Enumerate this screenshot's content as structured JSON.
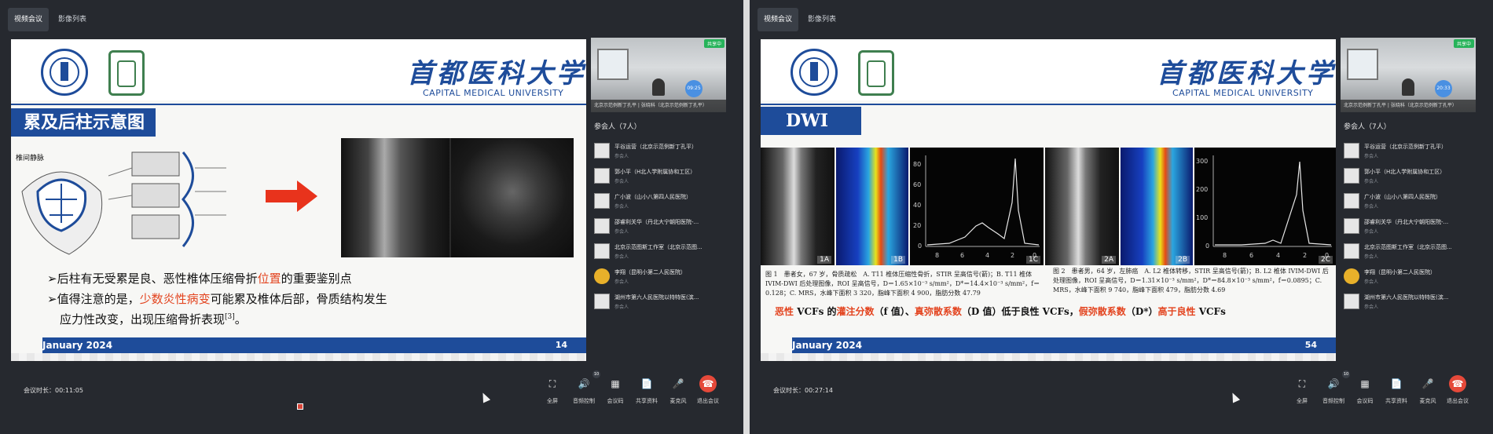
{
  "left": {
    "tabs": [
      "视频会议",
      "影像列表"
    ],
    "slide": {
      "university_zh": "首都医科大学",
      "university_en": "CAPITAL MEDICAL UNIVERSITY",
      "title": "累及后柱示意图",
      "diagram_label": "椎间静脉",
      "bullet1": "➢后柱有无受累是良、恶性椎体压缩骨折",
      "bullet1_hl": "位置",
      "bullet1_end": "的重要鉴别点",
      "bullet2_start": "➢值得注意的是，",
      "bullet2_hl": "少数炎性病变",
      "bullet2_end": "可能累及椎体后部，骨质结构发生",
      "bullet3": "应力性改变，出现压缩骨折表现",
      "bullet3_ref": "[3]",
      "bullet3_end": "。",
      "footer_date": "January 2024",
      "page": "14"
    },
    "side": {
      "sharing": "共享中",
      "time": "09:25",
      "video_caption": "北京示范例新丁孔平 | 张晓科（北京示范例新丁孔平）",
      "participants_title": "参会人（7人）",
      "participants": [
        {
          "name": "平谷运营（北京示范例新丁孔平）",
          "role": "参会人"
        },
        {
          "name": "郭小平（H北人学附属协和工区）",
          "role": "参会人"
        },
        {
          "name": "广小波（山小八第四人民医院）",
          "role": "参会人"
        },
        {
          "name": "邵睿利关华（丹北大宁朝阳医院-...",
          "role": "参会人"
        },
        {
          "name": "北京示范图斯工作室（北京示范图...",
          "role": "参会人"
        },
        {
          "name": "李翔（昆明小第二人民医院）",
          "role": "参会人"
        },
        {
          "name": "湖州市第六人民医院以特特医(滨...",
          "role": "参会人"
        }
      ]
    },
    "duration": "会议时长：00:11:05"
  },
  "right": {
    "tabs": [
      "视频会议",
      "影像列表"
    ],
    "slide": {
      "university_zh": "首都医科大学",
      "university_en": "CAPITAL MEDICAL UNIVERSITY",
      "title": "DWI",
      "panel_labels": [
        "1A",
        "1B",
        "1C",
        "2A",
        "2B",
        "2C"
      ],
      "plot1_yticks": [
        "80",
        "60",
        "40",
        "20",
        "0"
      ],
      "plot1_xticks": [
        "8",
        "6",
        "4",
        "2",
        "0"
      ],
      "plot2_yticks": [
        "300",
        "200",
        "100",
        "0"
      ],
      "plot2_xticks": [
        "8",
        "6",
        "4",
        "2",
        "0"
      ],
      "caption1": "图 1　患者女，67 岁，骨质疏松　A. T11 椎体压缩性骨折，STIR 呈高信号(箭)；B. T11 椎体 IVIM-DWI 后处理图像，ROI 呈高信号，D＝1.65×10⁻³ s/mm²，D*＝14.4×10⁻³ s/mm²，f＝0.128；C. MRS，水峰下面积 3 320，脂峰下面积 4 900，脂肪分数 47.79",
      "caption2": "图 2　患者男，64 岁，左肺癌　A. L2 椎体转移，STIR 呈高信号(箭)；B. L2 椎体 IVIM-DWI 后处理图像，ROI 呈高信号，D＝1.31×10⁻³ s/mm²，D*＝84.8×10⁻³ s/mm²，f＝0.0895；C. MRS，水峰下面积 9 740，脂峰下面积 479，脂肪分数 4.69",
      "summary_parts": [
        "恶性",
        " VCFs 的",
        "灌注分数",
        "（f 值）、",
        "真弥散系数",
        "（D 值）低于良性 VCFs，",
        "假弥散系数",
        "（D*）",
        "高于良性",
        " VCFs"
      ],
      "footer_date": "January 2024",
      "page": "54"
    },
    "side": {
      "sharing": "共享中",
      "time": "20:33",
      "video_caption": "北京示范例新丁孔平 | 张晓科（北京示范例新丁孔平）",
      "participants_title": "参会人（7人）",
      "participants": [
        {
          "name": "平谷运营（北京示范例新丁孔平）",
          "role": "参会人"
        },
        {
          "name": "郭小平（H北人学附属协和工区）",
          "role": "参会人"
        },
        {
          "name": "广小波（山小八第四人民医院）",
          "role": "参会人"
        },
        {
          "name": "邵睿利关华（丹北大宁朝阳医院-...",
          "role": "参会人"
        },
        {
          "name": "北京示范图斯工作室（北京示范图...",
          "role": "参会人"
        },
        {
          "name": "李翔（昆明小第二人民医院）",
          "role": "参会人"
        },
        {
          "name": "湖州市第六人民医院以特特医(滨...",
          "role": "参会人"
        }
      ]
    },
    "duration": "会议时长：00:27:14"
  },
  "controls": [
    {
      "label": "全屏",
      "icon": "fullscreen-icon",
      "glyph": "⛶"
    },
    {
      "label": "音频控制",
      "icon": "speaker-icon",
      "glyph": "🔊",
      "badge": "10"
    },
    {
      "label": "会议码",
      "icon": "qrcode-icon",
      "glyph": "▦"
    },
    {
      "label": "共享资料",
      "icon": "document-icon",
      "glyph": "📄"
    },
    {
      "label": "麦克风",
      "icon": "microphone-icon",
      "glyph": "🎤"
    },
    {
      "label": "退出会议",
      "icon": "hangup-icon",
      "glyph": "☎",
      "color": "#e5493a"
    }
  ]
}
